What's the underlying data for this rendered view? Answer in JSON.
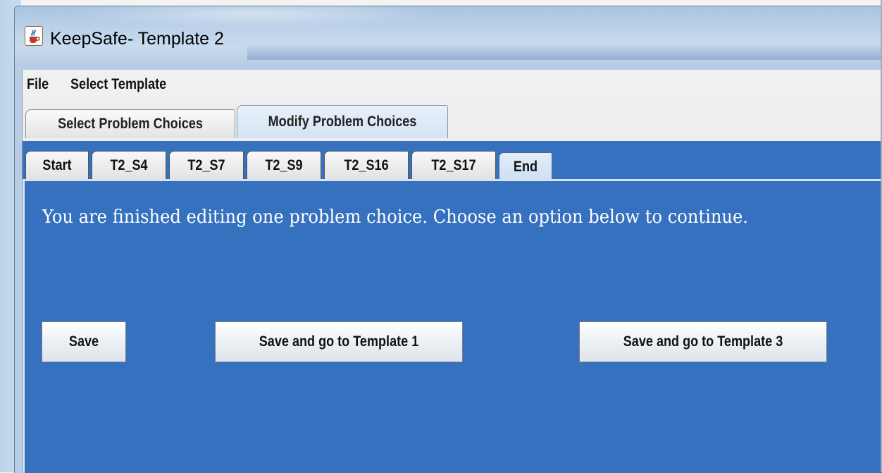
{
  "window": {
    "title": "KeepSafe- Template 2",
    "icon": "java-cup-icon"
  },
  "menu": {
    "items": [
      {
        "label": "File"
      },
      {
        "label": "Select Template"
      }
    ]
  },
  "outer_tabs": [
    {
      "label": "Select Problem Choices",
      "active": false
    },
    {
      "label": "Modify Problem Choices",
      "active": true
    }
  ],
  "inner_tabs": [
    {
      "label": "Start",
      "active": false
    },
    {
      "label": "T2_S4",
      "active": false
    },
    {
      "label": "T2_S7",
      "active": false
    },
    {
      "label": "T2_S9",
      "active": false
    },
    {
      "label": "T2_S16",
      "active": false
    },
    {
      "label": "T2_S17",
      "active": false
    },
    {
      "label": "End",
      "active": true
    }
  ],
  "panel": {
    "message": "You are finished editing one problem choice. Choose an option below to continue.",
    "buttons": {
      "save": "Save",
      "save_template1": "Save and go to Template 1",
      "save_template3": "Save and go to Template 3"
    }
  },
  "colors": {
    "panel_background": "#3571bf",
    "message_text": "#ffffff"
  }
}
